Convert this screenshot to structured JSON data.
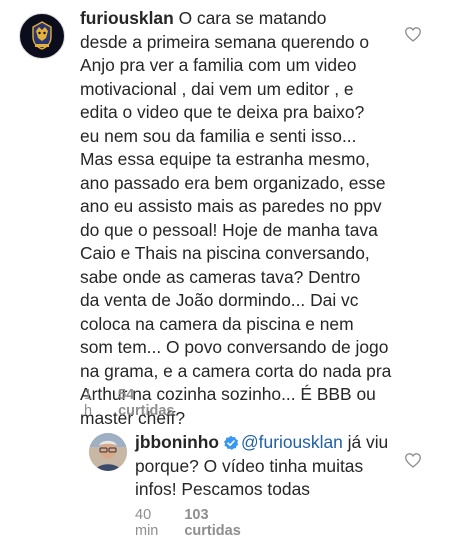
{
  "comment": {
    "username": "furiousklan",
    "text": "O cara se matando\ndesde a primeira semana querendo o\nAnjo pra ver a familia com um video\nmotivacional , dai vem um editor , e\nedita o video que te deixa pra baixo?\neu nem sou da familia e senti isso...\nMas essa equipe ta estranha mesmo,\nano passado era bem organizado, esse\nano eu assisto mais as paredes no ppv\ndo que o pessoal! Hoje de manha tava\nCaio e Thais na piscina conversando,\nsabe onde as cameras tava? Dentro\nda venta de João dormindo... Dai vc\ncoloca na camera da piscina e nem\nsom tem... O povo conversando de jogo\nna grama, e a camera corta do nada pra\nArthur na cozinha sozinho... É BBB ou\nmaster cheff?",
    "time": "1 h",
    "likes": "54 curtidas"
  },
  "reply": {
    "username": "jbboninho",
    "mention": "@furiousklan",
    "text": " já viu\nporque? O vídeo tinha muitas\ninfos! Pescamos todas",
    "time": "40 min",
    "likes": "103 curtidas"
  },
  "colors": {
    "text": "#262626",
    "muted": "#8e8e8e",
    "mention": "#1f5fa8",
    "verified": "#3897f0"
  },
  "icons": {
    "like": "heart-outline-icon",
    "verified": "verified-badge-icon"
  }
}
